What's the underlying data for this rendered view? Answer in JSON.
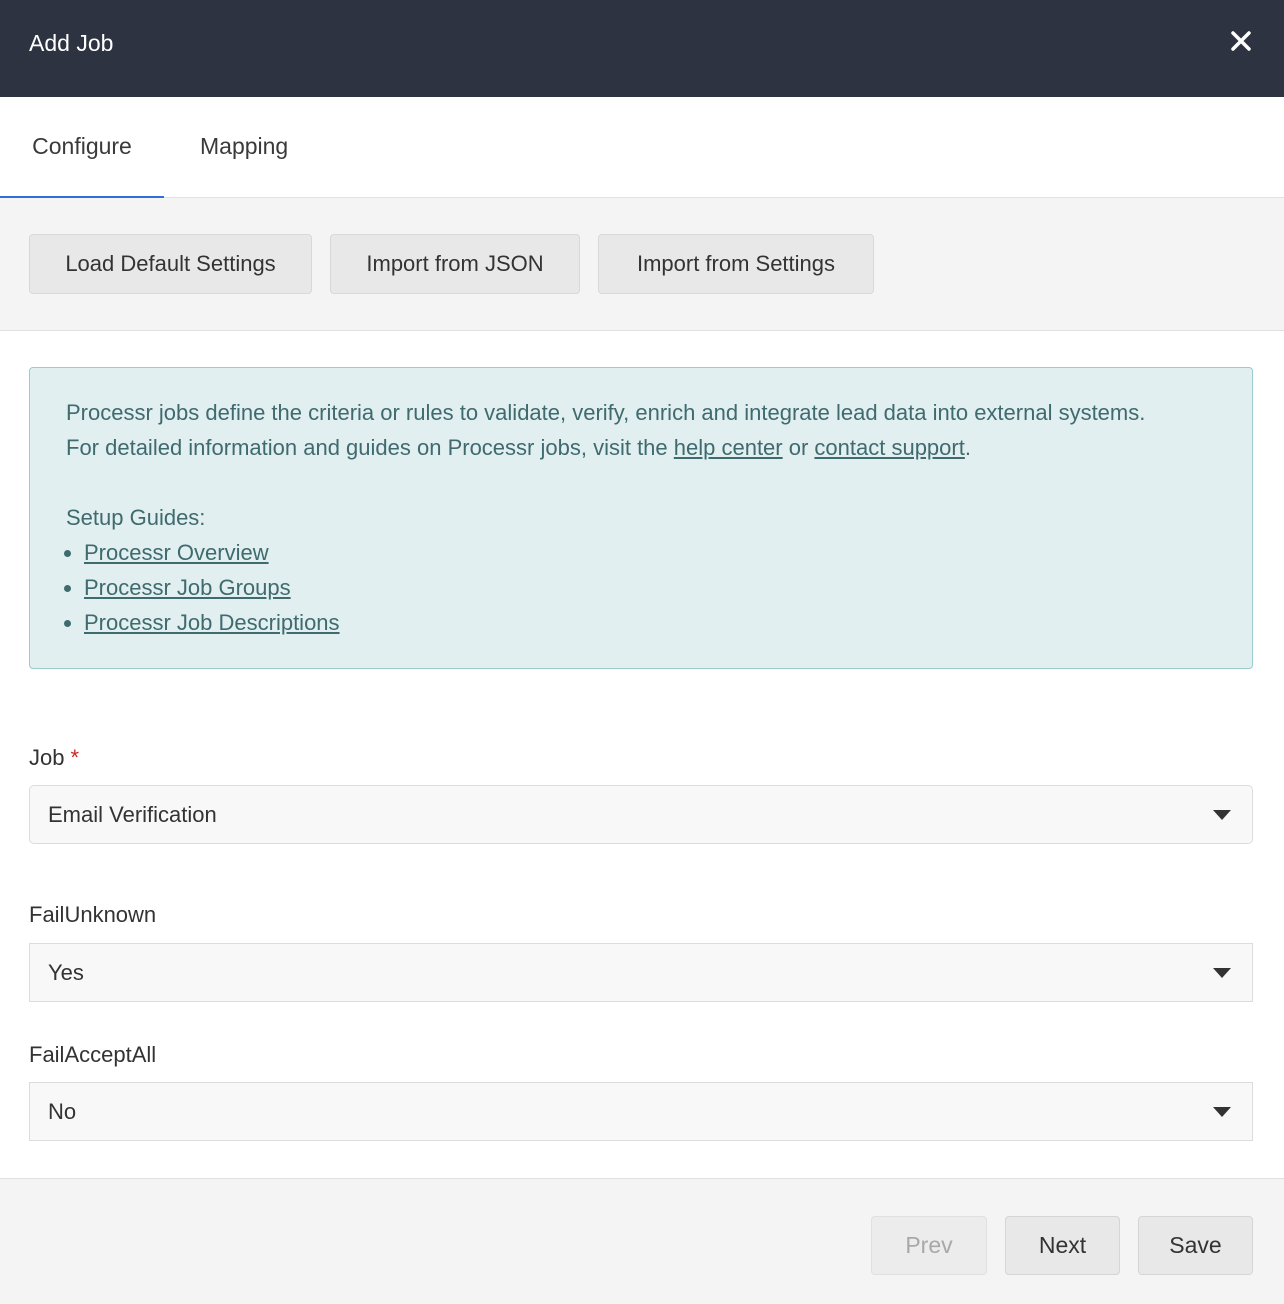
{
  "dialog": {
    "title": "Add Job",
    "close_icon": "close-icon"
  },
  "tabs": [
    {
      "label": "Configure",
      "active": true
    },
    {
      "label": "Mapping",
      "active": false
    }
  ],
  "toolbar": {
    "load_default": "Load Default Settings",
    "import_json": "Import from JSON",
    "import_settings": "Import from Settings"
  },
  "info": {
    "line1": "Processr jobs define the criteria or rules to validate, verify, enrich and integrate lead data into external systems.",
    "line2_prefix": "For detailed information and guides on Processr jobs, visit the ",
    "help_center": "help center",
    "or": " or ",
    "contact_support": "contact support",
    "period": ".",
    "setup_guides": "Setup Guides:",
    "guides": [
      "Processr Overview",
      "Processr Job Groups",
      "Processr Job Descriptions"
    ]
  },
  "form": {
    "job": {
      "label": "Job",
      "required_mark": "*",
      "value": "Email Verification"
    },
    "fail_unknown": {
      "label": "FailUnknown",
      "value": "Yes"
    },
    "fail_accept_all": {
      "label": "FailAcceptAll",
      "value": "No"
    }
  },
  "footer": {
    "prev": "Prev",
    "next": "Next",
    "save": "Save"
  },
  "colors": {
    "header_bg": "#2d3340",
    "tab_accent": "#2f6fdc",
    "info_bg": "#e1eff0",
    "info_text": "#3f6a6e",
    "required": "#c62828"
  }
}
